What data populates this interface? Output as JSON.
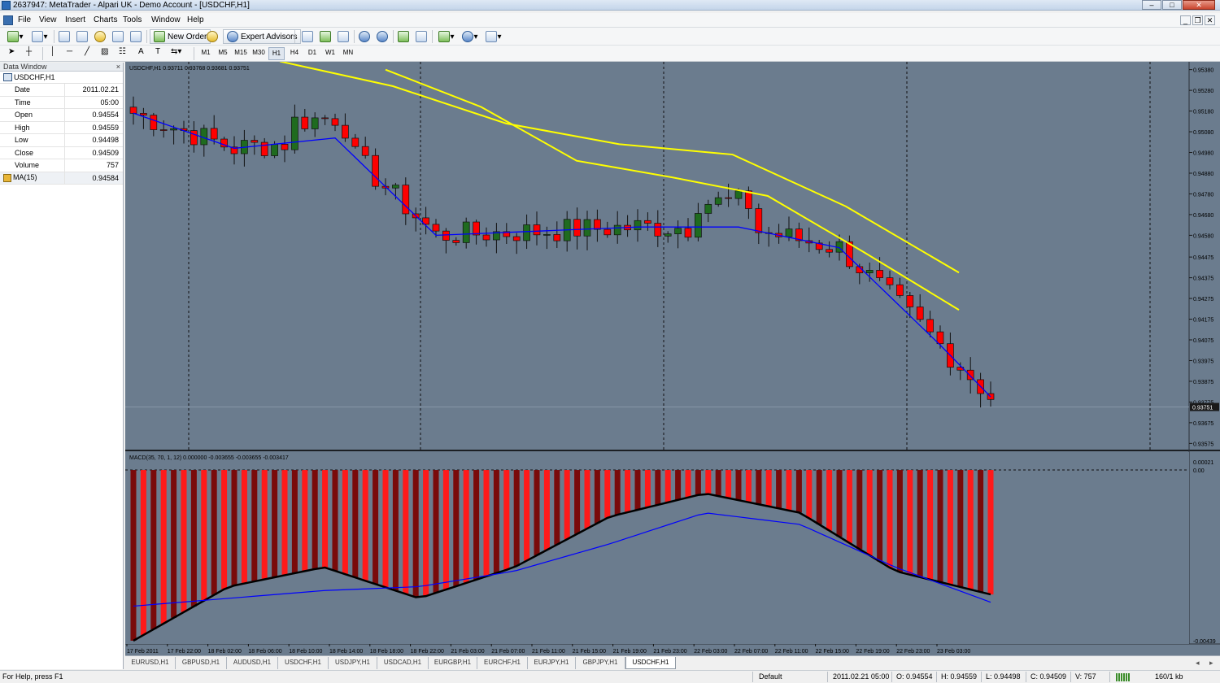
{
  "window": {
    "title": "2637947: MetaTrader - Alpari UK - Demo Account - [USDCHF,H1]",
    "min": "–",
    "max": "□",
    "close": "✕"
  },
  "menu": [
    "File",
    "View",
    "Insert",
    "Charts",
    "Tools",
    "Window",
    "Help"
  ],
  "mdi": {
    "min": "_",
    "restore": "❐",
    "close": "✕"
  },
  "toolbar": {
    "new_order": "New Order",
    "expert_advisors": "Expert Advisors",
    "timeframes": [
      "M1",
      "M5",
      "M15",
      "M30",
      "H1",
      "H4",
      "D1",
      "W1",
      "MN"
    ],
    "active_timeframe": "H1",
    "text_tool": "A",
    "textlabel_tool": "T"
  },
  "data_window": {
    "title": "Data Window",
    "close": "×",
    "symbol": "USDCHF,H1",
    "rows": [
      {
        "key": "Date",
        "value": "2011.02.21"
      },
      {
        "key": "Time",
        "value": "05:00"
      },
      {
        "key": "Open",
        "value": "0.94554"
      },
      {
        "key": "High",
        "value": "0.94559"
      },
      {
        "key": "Low",
        "value": "0.94498"
      },
      {
        "key": "Close",
        "value": "0.94509"
      },
      {
        "key": "Volume",
        "value": "757"
      }
    ],
    "indicator": {
      "key": "MA(15)",
      "value": "0.94584"
    }
  },
  "chart": {
    "header": "USDCHF,H1  0.93711 0.93768 0.93681 0.93751",
    "current_price": "0.93751",
    "price_ticks": [
      "0.95380",
      "0.95280",
      "0.95180",
      "0.95080",
      "0.94980",
      "0.94880",
      "0.94780",
      "0.94680",
      "0.94580",
      "0.94475",
      "0.94375",
      "0.94275",
      "0.94175",
      "0.94075",
      "0.93975",
      "0.93875",
      "0.93775",
      "0.93675",
      "0.93575"
    ],
    "macd_header": "MACD(35, 70, 1, 12) 0.000000 -0.003655 -0.003655 -0.003417",
    "macd_ticks": [
      "0.00021",
      "0.00",
      "-0.00439"
    ],
    "time_labels": [
      "17 Feb 2011",
      "17 Feb 22:00",
      "18 Feb 02:00",
      "18 Feb 06:00",
      "18 Feb 10:00",
      "18 Feb 14:00",
      "18 Feb 18:00",
      "18 Feb 22:00",
      "21 Feb 03:00",
      "21 Feb 07:00",
      "21 Feb 11:00",
      "21 Feb 15:00",
      "21 Feb 19:00",
      "21 Feb 23:00",
      "22 Feb 03:00",
      "22 Feb 07:00",
      "22 Feb 11:00",
      "22 Feb 15:00",
      "22 Feb 19:00",
      "22 Feb 23:00",
      "23 Feb 03:00"
    ],
    "colors": {
      "background": "#6b7c8e",
      "bull": "#1f6b1f",
      "bear": "#ff0000",
      "ma": "#0000ff",
      "envelope": "#ffff00",
      "histogram_dark": "#7a0a0a",
      "histogram_bright": "#ff1a1a"
    }
  },
  "chart_data": [
    {
      "type": "line",
      "title": "USDCHF,H1",
      "series": [
        {
          "name": "MA(15)",
          "x": [
            0,
            10,
            20,
            30,
            40,
            50,
            60,
            70,
            80,
            85
          ],
          "values": [
            0.9517,
            0.95,
            0.9505,
            0.9458,
            0.946,
            0.9462,
            0.9462,
            0.9452,
            0.9405,
            0.938
          ]
        },
        {
          "values": [
            0.9542,
            0.953,
            0.9512,
            0.9502,
            0.9497,
            0.9472,
            0.944
          ]
        },
        {
          "values": [
            0.9538,
            0.952,
            0.9494,
            0.9486,
            0.9477,
            0.945,
            0.9422
          ]
        }
      ]
    },
    {
      "type": "bar",
      "title": "MACD(35, 70, 1, 12)",
      "series": [
        {
          "name": "MACD",
          "values": [
            -0.00439,
            -0.003,
            -0.0025,
            -0.0033,
            -0.0025,
            -0.0012,
            -0.0006,
            -0.0011,
            -0.0026,
            -0.0032
          ]
        },
        {
          "name": "Signal",
          "values": [
            -0.0035,
            -0.0033,
            -0.0031,
            -0.003,
            -0.0026,
            -0.0019,
            -0.0011,
            -0.0014,
            -0.0025,
            -0.0034
          ]
        }
      ],
      "ylim": [
        -0.00439,
        0.00021
      ]
    }
  ],
  "tabs": [
    "EURUSD,H1",
    "GBPUSD,H1",
    "AUDUSD,H1",
    "USDCHF,H1",
    "USDJPY,H1",
    "USDCAD,H1",
    "EURGBP,H1",
    "EURCHF,H1",
    "EURJPY,H1",
    "GBPJPY,H1",
    "USDCHF,H1"
  ],
  "active_tab_index": 10,
  "status": {
    "help": "For Help, press F1",
    "profile": "Default",
    "datetime": "2011.02.21 05:00",
    "open": "O: 0.94554",
    "high": "H: 0.94559",
    "low": "L: 0.94498",
    "close": "C: 0.94509",
    "volume": "V: 757",
    "traffic": "160/1 kb"
  }
}
